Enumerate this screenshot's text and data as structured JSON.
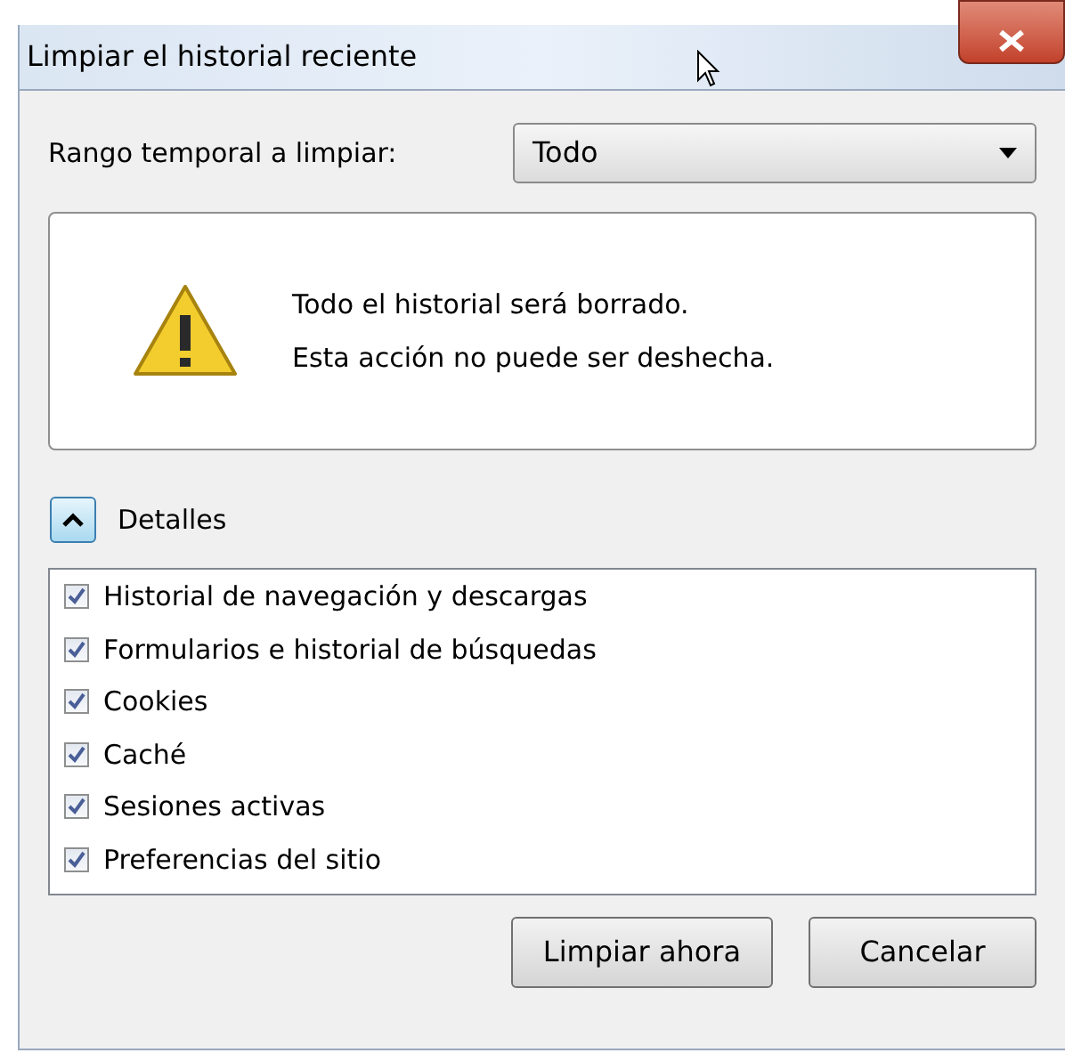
{
  "window": {
    "title": "Limpiar el historial reciente"
  },
  "range": {
    "label": "Rango temporal a limpiar:",
    "value": "Todo"
  },
  "warning": {
    "lines": [
      "Todo el historial será borrado.",
      "Esta acción no puede ser deshecha."
    ]
  },
  "details": {
    "label": "Detalles",
    "expanded": true
  },
  "items": [
    {
      "label": "Historial de navegación y descargas",
      "checked": true
    },
    {
      "label": "Formularios e historial de búsquedas",
      "checked": true
    },
    {
      "label": "Cookies",
      "checked": true
    },
    {
      "label": "Caché",
      "checked": true
    },
    {
      "label": "Sesiones activas",
      "checked": true
    },
    {
      "label": "Preferencias del sitio",
      "checked": true
    }
  ],
  "buttons": [
    "Limpiar ahora",
    "Cancelar"
  ]
}
